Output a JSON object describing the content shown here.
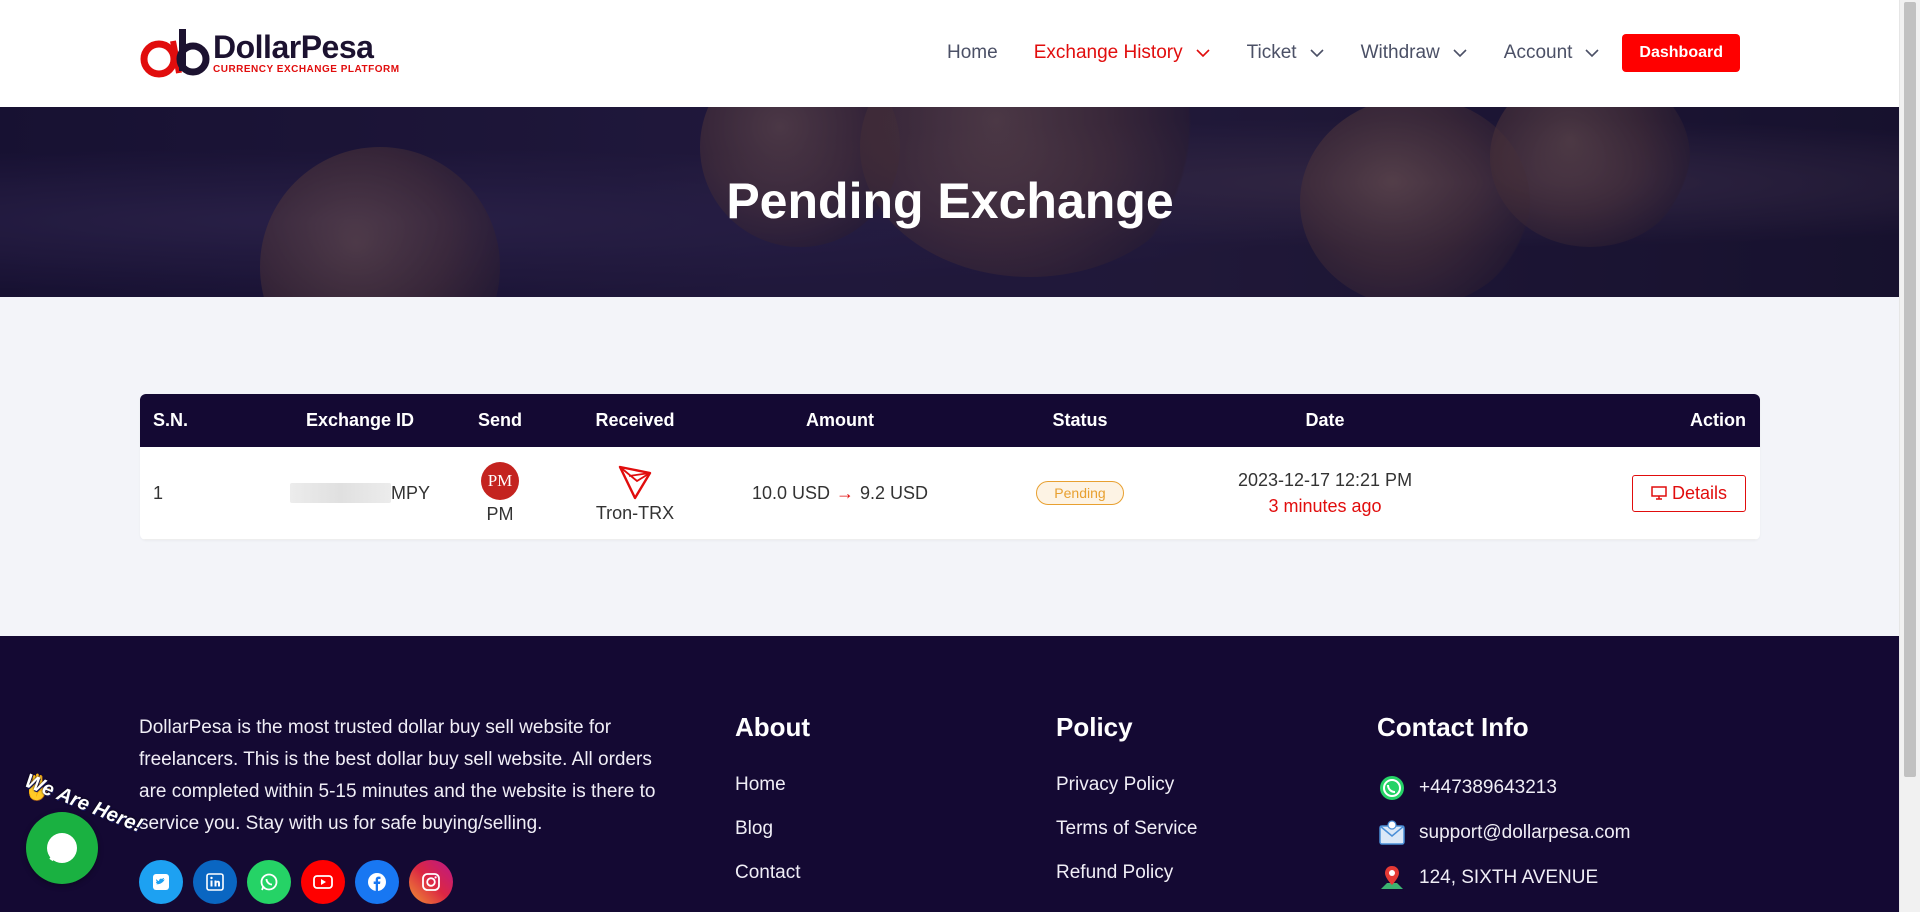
{
  "brand": {
    "name": "DollarPesa",
    "tagline": "CURRENCY EXCHANGE PLATFORM",
    "primary_color": "#e10d0d",
    "dark_color": "#140933"
  },
  "nav": {
    "items": [
      {
        "label": "Home",
        "has_dropdown": false,
        "active": false
      },
      {
        "label": "Exchange History",
        "has_dropdown": true,
        "active": true
      },
      {
        "label": "Ticket",
        "has_dropdown": true,
        "active": false
      },
      {
        "label": "Withdraw",
        "has_dropdown": true,
        "active": false
      },
      {
        "label": "Account",
        "has_dropdown": true,
        "active": false
      }
    ],
    "dashboard_label": "Dashboard"
  },
  "banner": {
    "title": "Pending Exchange"
  },
  "table": {
    "headers": [
      "S.N.",
      "Exchange ID",
      "Send",
      "Received",
      "Amount",
      "Status",
      "Date",
      "Action"
    ],
    "rows": [
      {
        "sn": "1",
        "exchange_id_suffix": "MPY",
        "send_icon_text": "PM",
        "send_name": "PM",
        "received_name": "Tron-TRX",
        "amount_send": "10.0 USD",
        "amount_arrow": "→",
        "amount_receive": "9.2 USD",
        "status": "Pending",
        "date": "2023-12-17 12:21 PM",
        "ago": "3 minutes ago",
        "action_label": "Details"
      }
    ]
  },
  "footer": {
    "description": "DollarPesa is the most trusted dollar buy sell website for freelancers. This is the best dollar buy sell website. All orders are completed within 5-15 minutes and the website is there to service you. Stay with us for safe buying/selling.",
    "social": [
      {
        "name": "twitter-icon",
        "color": "#1da1f2"
      },
      {
        "name": "linkedin-icon",
        "color": "#0a66c2"
      },
      {
        "name": "whatsapp-icon",
        "color": "#25d366"
      },
      {
        "name": "youtube-icon",
        "color": "#ff0000"
      },
      {
        "name": "facebook-icon",
        "color": "#1877f2"
      },
      {
        "name": "instagram-icon",
        "color": "#d6249f"
      }
    ],
    "about": {
      "title": "About",
      "links": [
        "Home",
        "Blog",
        "Contact"
      ]
    },
    "policy": {
      "title": "Policy",
      "links": [
        "Privacy Policy",
        "Terms of Service",
        "Refund Policy"
      ]
    },
    "contact": {
      "title": "Contact Info",
      "phone": "+447389643213",
      "email": "support@dollarpesa.com",
      "address": "124, SIXTH AVENUE"
    }
  },
  "chat_widget": {
    "label": "We Are Here!"
  }
}
